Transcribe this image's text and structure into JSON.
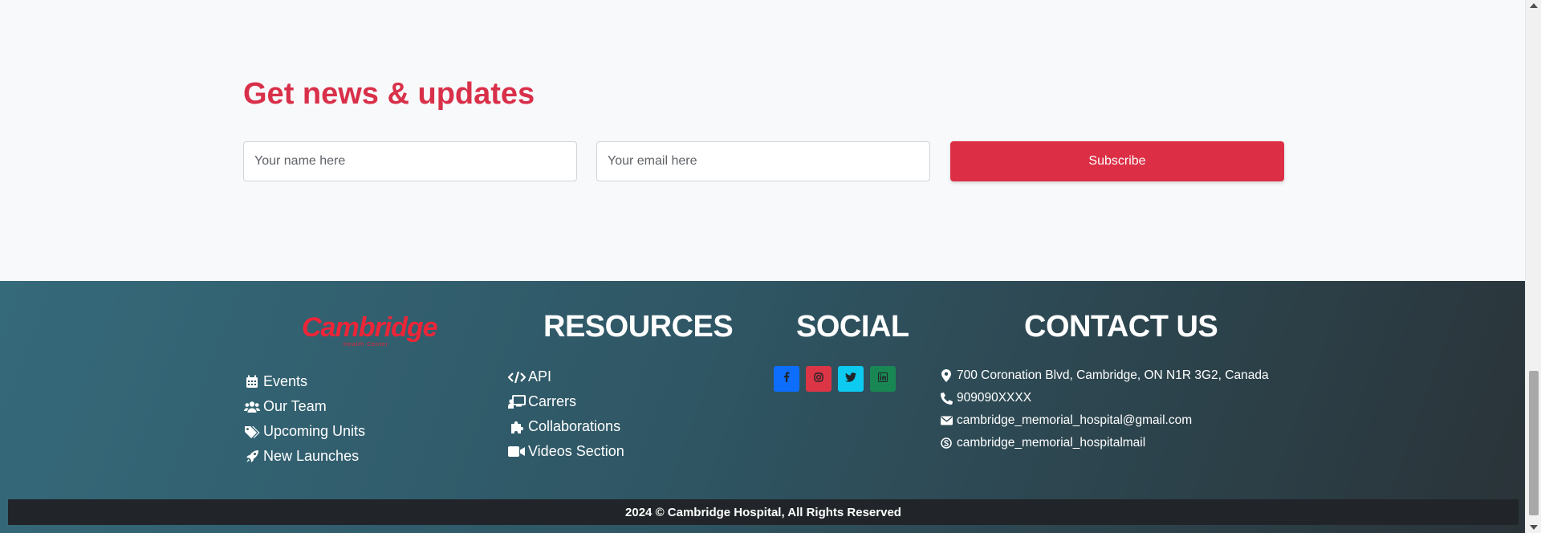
{
  "newsletter": {
    "title": "Get news & updates",
    "name_placeholder": "Your name here",
    "email_placeholder": "Your email here",
    "subscribe_label": "Subscribe"
  },
  "footer": {
    "logo": {
      "name": "Cambridge",
      "tagline": "Health Center"
    },
    "quick_links": [
      {
        "label": "Events",
        "icon": "calendar-icon"
      },
      {
        "label": "Our Team",
        "icon": "users-icon"
      },
      {
        "label": "Upcoming Units",
        "icon": "tags-icon"
      },
      {
        "label": "New Launches",
        "icon": "rocket-icon"
      }
    ],
    "resources": {
      "heading": "RESOURCES",
      "items": [
        {
          "label": "API",
          "icon": "code-icon"
        },
        {
          "label": "Carrers",
          "icon": "chalkboard-user-icon"
        },
        {
          "label": "Collaborations",
          "icon": "puzzle-icon"
        },
        {
          "label": "Videos Section",
          "icon": "video-icon"
        }
      ]
    },
    "social": {
      "heading": "SOCIAL",
      "items": [
        {
          "name": "facebook",
          "icon": "facebook-icon",
          "color": "#0d6efd"
        },
        {
          "name": "instagram",
          "icon": "instagram-icon",
          "color": "#dc3545"
        },
        {
          "name": "twitter",
          "icon": "twitter-icon",
          "color": "#0dcaf0"
        },
        {
          "name": "linkedin",
          "icon": "linkedin-icon",
          "color": "#198754"
        }
      ]
    },
    "contact": {
      "heading": "CONTACT US",
      "items": [
        {
          "text": "700 Coronation Blvd, Cambridge, ON N1R 3G2, Canada",
          "icon": "location-pin-icon"
        },
        {
          "text": "909090XXXX",
          "icon": "phone-icon"
        },
        {
          "text": "cambridge_memorial_hospital@gmail.com",
          "icon": "envelope-icon"
        },
        {
          "text": "cambridge_memorial_hospitalmail",
          "icon": "skype-icon"
        }
      ]
    },
    "copyright": "2024 © Cambridge Hospital, All Rights Reserved"
  },
  "colors": {
    "accent_red": "#dc2f45",
    "footer_bg_start": "#356a7b",
    "footer_bg_end": "#2a3338",
    "copyright_bg": "#212529"
  }
}
